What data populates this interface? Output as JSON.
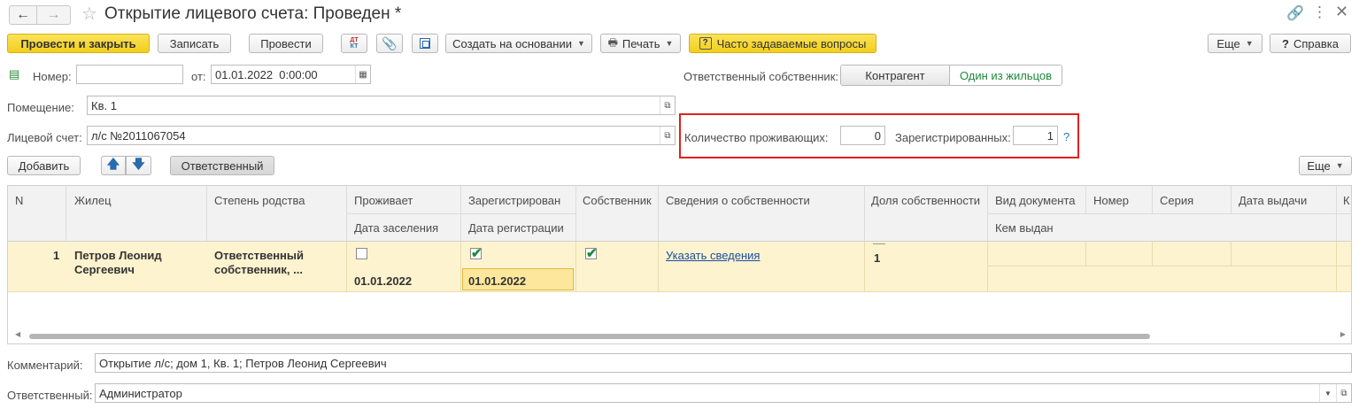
{
  "window": {
    "title": "Открытие лицевого счета: Проведен *"
  },
  "toolbar": {
    "post_close": "Провести и закрыть",
    "save": "Записать",
    "post": "Провести",
    "dt_kt": "ДТ КТ",
    "create_based": "Создать на основании",
    "print": "Печать",
    "faq": "Часто задаваемые вопросы",
    "more": "Еще",
    "help": "Справка"
  },
  "form": {
    "number_label": "Номер:",
    "number_value": "",
    "from_label": "от:",
    "date_value": "01.01.2022  0:00:00",
    "premises_label": "Помещение:",
    "premises_value": "Кв. 1",
    "account_label": "Лицевой счет:",
    "account_value": "л/с №2011067054",
    "owner_label": "Ответственный собственник:",
    "owner_toggle": [
      "Контрагент",
      "Один из жильцов"
    ],
    "residents_label": "Количество проживающих:",
    "residents_value": "0",
    "registered_label": "Зарегистрированных:",
    "registered_value": "1",
    "help_q": "?"
  },
  "table_toolbar": {
    "add": "Добавить",
    "responsible": "Ответственный",
    "more": "Еще"
  },
  "table": {
    "headers": {
      "n": "N",
      "tenant": "Жилец",
      "relation": "Степень родства",
      "lives": "Проживает",
      "lives_sub": "Дата заселения",
      "registered": "Зарегистрирован",
      "registered_sub": "Дата регистрации",
      "owner": "Собственник",
      "ownership_info": "Сведения о собственности",
      "share": "Доля собственности",
      "doc_type": "Вид документа",
      "doc_type_sub": "Кем выдан",
      "doc_number": "Номер",
      "doc_series": "Серия",
      "issue_date": "Дата выдачи",
      "next": "К"
    },
    "rows": [
      {
        "n": "1",
        "tenant": "Петров Леонид Сергеевич",
        "relation": "Ответственный собственник, ...",
        "lives": false,
        "move_in_date": "01.01.2022",
        "registered": true,
        "reg_date": "01.01.2022",
        "owner": true,
        "ownership_link": "Указать сведения",
        "share": "1"
      }
    ]
  },
  "footer": {
    "comment_label": "Комментарий:",
    "comment_value": "Открытие л/с; дом 1, Кв. 1; Петров Леонид Сергеевич",
    "responsible_label": "Ответственный:",
    "responsible_value": "Администратор"
  },
  "colors": {
    "accent_yellow": "#f2cf1c",
    "row_highlight": "#fdf3cf",
    "highlight_box": "#e02020",
    "link": "#1a4ea0",
    "toggle_active": "#1e8a3a"
  }
}
